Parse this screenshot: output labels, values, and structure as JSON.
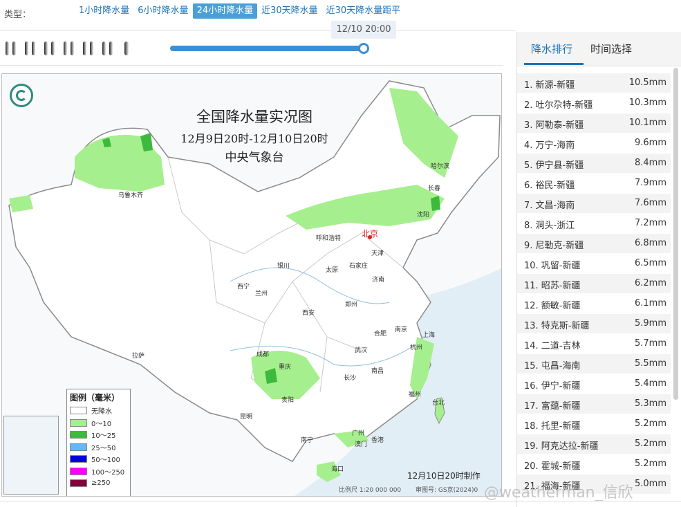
{
  "type_bar": {
    "label": "类型：",
    "tabs": [
      {
        "label": "1小时降水量"
      },
      {
        "label": "6小时降水量"
      },
      {
        "label": "24小时降水量",
        "active": true
      },
      {
        "label": "近30天降水量"
      },
      {
        "label": "近30天降水量距平"
      }
    ]
  },
  "player": {
    "current_time": "12/10 20:00",
    "progress": 1.0
  },
  "map": {
    "title": "全国降水量实况图",
    "period": "12月9日20时-12月10日20时",
    "agency": "中央气象台",
    "made_at": "12月10日20时制作",
    "scale": "比例尺 1:20 000 000",
    "review_no": "审图号: GS京(2024)0",
    "cities": [
      {
        "name": "哈尔滨"
      },
      {
        "name": "长春"
      },
      {
        "name": "沈阳"
      },
      {
        "name": "乌鲁木齐"
      },
      {
        "name": "呼和浩特"
      },
      {
        "name": "北京"
      },
      {
        "name": "天津"
      },
      {
        "name": "银川"
      },
      {
        "name": "太原"
      },
      {
        "name": "石家庄"
      },
      {
        "name": "西宁"
      },
      {
        "name": "兰州"
      },
      {
        "name": "济南"
      },
      {
        "name": "郑州"
      },
      {
        "name": "西安"
      },
      {
        "name": "合肥"
      },
      {
        "name": "南京"
      },
      {
        "name": "上海"
      },
      {
        "name": "杭州"
      },
      {
        "name": "拉萨"
      },
      {
        "name": "成都"
      },
      {
        "name": "武汉"
      },
      {
        "name": "重庆"
      },
      {
        "name": "长沙"
      },
      {
        "name": "南昌"
      },
      {
        "name": "贵阳"
      },
      {
        "name": "福州"
      },
      {
        "name": "台北"
      },
      {
        "name": "昆明"
      },
      {
        "name": "南宁"
      },
      {
        "name": "广州"
      },
      {
        "name": "香港"
      },
      {
        "name": "澳门"
      },
      {
        "name": "海口"
      }
    ],
    "legend": {
      "title": "图例（毫米）",
      "items": [
        {
          "label": "无降水",
          "color": "#ffffff"
        },
        {
          "label": "0～10",
          "color": "#a6ef8e"
        },
        {
          "label": "10～25",
          "color": "#3dba3d"
        },
        {
          "label": "25～50",
          "color": "#61b8ff"
        },
        {
          "label": "50～100",
          "color": "#0000e1"
        },
        {
          "label": "100～250",
          "color": "#fa00fa"
        },
        {
          "label": "≥250",
          "color": "#800040"
        }
      ]
    }
  },
  "panel": {
    "tabs": [
      {
        "label": "降水排行",
        "active": true
      },
      {
        "label": "时间选择"
      }
    ],
    "ranking": [
      {
        "name": "1. 新源-新疆",
        "value": "10.5mm"
      },
      {
        "name": "2. 吐尔尕特-新疆",
        "value": "10.3mm"
      },
      {
        "name": "3. 阿勒泰-新疆",
        "value": "10.1mm"
      },
      {
        "name": "4. 万宁-海南",
        "value": "9.6mm"
      },
      {
        "name": "5. 伊宁县-新疆",
        "value": "8.4mm"
      },
      {
        "name": "6. 裕民-新疆",
        "value": "7.9mm"
      },
      {
        "name": "7. 文昌-海南",
        "value": "7.6mm"
      },
      {
        "name": "8. 洞头-浙江",
        "value": "7.2mm"
      },
      {
        "name": "9. 尼勒克-新疆",
        "value": "6.8mm"
      },
      {
        "name": "10. 巩留-新疆",
        "value": "6.5mm"
      },
      {
        "name": "11. 昭苏-新疆",
        "value": "6.2mm"
      },
      {
        "name": "12. 额敏-新疆",
        "value": "6.1mm"
      },
      {
        "name": "13. 特克斯-新疆",
        "value": "5.9mm"
      },
      {
        "name": "14. 二道-吉林",
        "value": "5.7mm"
      },
      {
        "name": "15. 屯昌-海南",
        "value": "5.5mm"
      },
      {
        "name": "16. 伊宁-新疆",
        "value": "5.4mm"
      },
      {
        "name": "17. 富蕴-新疆",
        "value": "5.3mm"
      },
      {
        "name": "18. 托里-新疆",
        "value": "5.2mm"
      },
      {
        "name": "19. 阿克达拉-新疆",
        "value": "5.2mm"
      },
      {
        "name": "20. 霍城-新疆",
        "value": "5.2mm"
      },
      {
        "name": "21. 福海-新疆",
        "value": "5.0mm"
      }
    ]
  },
  "watermark": "@weatherman_信欣"
}
